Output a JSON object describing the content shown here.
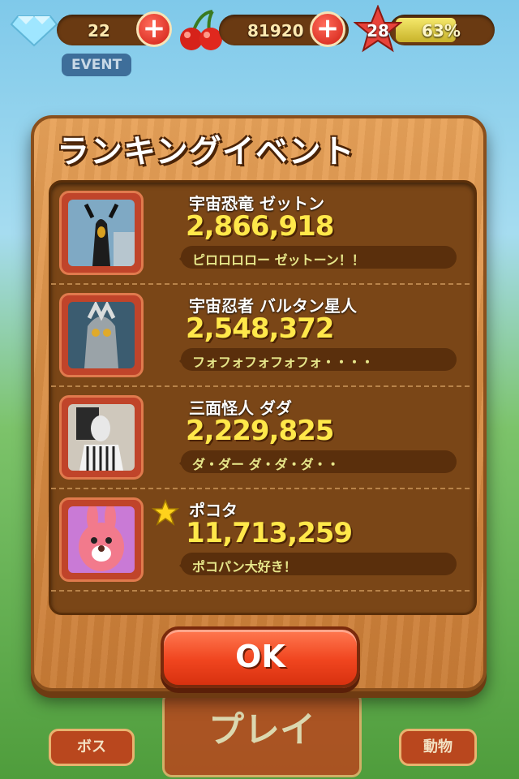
{
  "hud": {
    "gems": "22",
    "cherries": "81920",
    "level": "28",
    "progress_text": "63%",
    "progress": 0.63,
    "event_tag": "EVENT"
  },
  "dialog": {
    "title": "ランキングイベント",
    "entries": [
      {
        "name": "宇宙恐竜 ゼットン",
        "score": "2,866,918",
        "message": "ピロロロロー ゼットーン！！",
        "favorite": false
      },
      {
        "name": "宇宙忍者 バルタン星人",
        "score": "2,548,372",
        "message": "フォフォフォフォフォ・・・・",
        "favorite": false
      },
      {
        "name": "三面怪人 ダダ",
        "score": "2,229,825",
        "message": "ダ・ダー ダ・ダ・ダ・・",
        "favorite": false
      },
      {
        "name": "ポコタ",
        "score": "11,713,259",
        "message": "ポコパン大好き！",
        "favorite": true
      }
    ],
    "ok_label": "OK"
  },
  "background": {
    "left_button": "ボス",
    "center_button": "プレイ",
    "right_button": "動物"
  },
  "colors": {
    "score_yellow": "#ffe84a",
    "ok_red": "#f0451f",
    "wood": "#d88d44"
  }
}
